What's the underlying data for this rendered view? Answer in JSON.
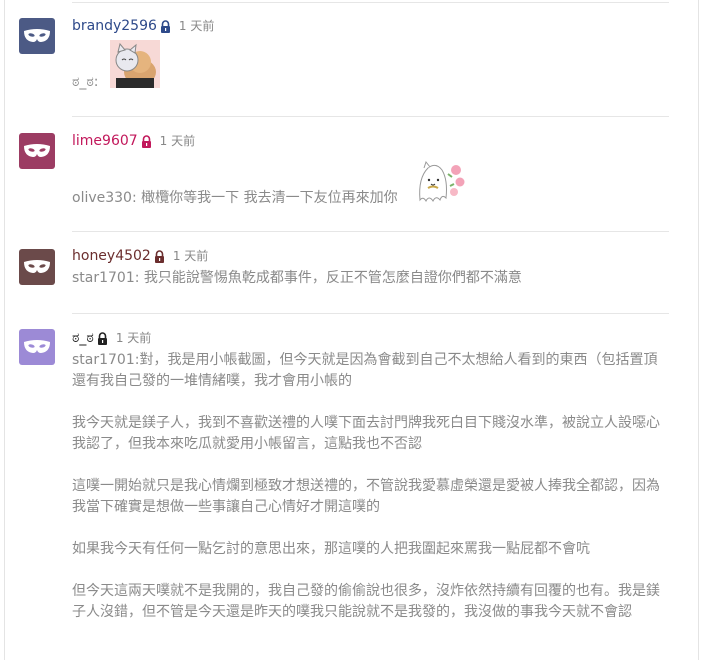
{
  "comments": [
    {
      "username": "brandy2596",
      "username_color": "#2e4a8a",
      "avatar_color": "#4c5a85",
      "time": "1 天前",
      "text": "ಠ_ಠ:",
      "sticker": "cat-dog-hug-sticker"
    },
    {
      "username": "lime9607",
      "username_color": "#c2185b",
      "avatar_color": "#9c3c63",
      "time": "1 天前",
      "text": "olive330: 橄欖你等我一下 我去清一下友位再來加你",
      "sticker": "ghost-flower-sticker"
    },
    {
      "username": "honey4502",
      "username_color": "#6b2e2e",
      "avatar_color": "#6b4a4a",
      "time": "1 天前",
      "text": "star1701: 我只能說警惕魚乾成都事件，反正不管怎麼自證你們都不滿意"
    },
    {
      "username": "ಠ_ಠ",
      "username_color": "#222222",
      "avatar_color": "#9c8ad6",
      "time": "1 天前",
      "paragraphs": [
        "star1701:對，我是用小帳截圖，但今天就是因為會截到自己不太想給人看到的東西（包括置頂還有我自己發的一堆情緒噗，我才會用小帳的",
        "我今天就是鎂子人，我到不喜歡送禮的人噗下面去討門牌我死白目下賤沒水準，被說立人設噁心我認了，但我本來吃瓜就愛用小帳留言，這點我也不否認",
        "這噗一開始就只是我心情爛到極致才想送禮的，不管說我愛慕虛榮還是愛被人捧我全都認，因為我當下確實是想做一些事讓自己心情好才開這噗的",
        "如果我今天有任何一點乞討的意思出來，那這噗的人把我圍起來罵我一點屁都不會吭",
        "但今天這兩天噗就不是我開的，我自己發的偷偷說也很多，沒炸依然持續有回覆的也有。我是鎂子人沒錯，但不管是今天還是昨天的噗我只能說就不是我發的，我沒做的事我今天就不會認"
      ]
    }
  ],
  "icons": {
    "avatar": "mask-icon",
    "privacy": "lock-icon"
  }
}
